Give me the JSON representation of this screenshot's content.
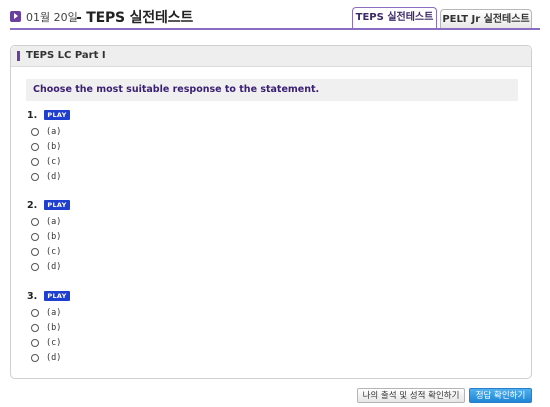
{
  "header": {
    "date": "01월 20일",
    "title": "- TEPS 실전테스트"
  },
  "tabs": [
    {
      "label": "TEPS 실전테스트",
      "active": true
    },
    {
      "label": "PELT Jr 실전테스트",
      "active": false
    }
  ],
  "panel": {
    "title": "TEPS LC Part I",
    "instruction": "Choose the most suitable response to the statement."
  },
  "questions": [
    {
      "number": "1.",
      "play_label": "PLAY",
      "options": [
        "(a)",
        "(b)",
        "(c)",
        "(d)"
      ]
    },
    {
      "number": "2.",
      "play_label": "PLAY",
      "options": [
        "(a)",
        "(b)",
        "(c)",
        "(d)"
      ]
    },
    {
      "number": "3.",
      "play_label": "PLAY",
      "options": [
        "(a)",
        "(b)",
        "(c)",
        "(d)"
      ]
    }
  ],
  "buttons": {
    "record": "나의 출석 및 성적 확인하기",
    "answer": "정답 확인하기"
  },
  "colors": {
    "accent": "#6a3fa0",
    "play": "#1f3fd0",
    "answer_button": "#1f86d6"
  }
}
